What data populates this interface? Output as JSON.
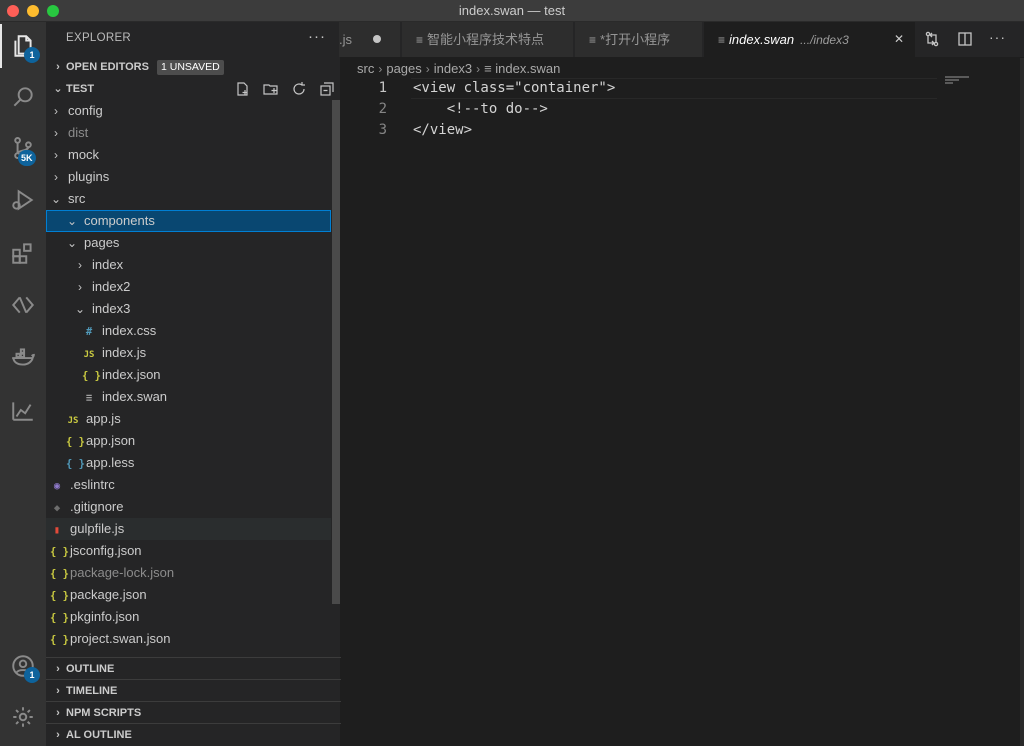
{
  "window": {
    "title": "index.swan — test"
  },
  "activity": {
    "explorer_badge": "1",
    "scm_badge": "5K",
    "accounts_badge": "1"
  },
  "sidebar": {
    "title": "EXPLORER",
    "more": "···",
    "open_editors": {
      "label": "OPEN EDITORS",
      "badge": "1 UNSAVED"
    },
    "folder": {
      "label": "TEST"
    },
    "tree": [
      {
        "label": "config",
        "type": "folder",
        "open": false,
        "depth": 1
      },
      {
        "label": "dist",
        "type": "folder",
        "open": false,
        "depth": 1,
        "dim": true
      },
      {
        "label": "mock",
        "type": "folder",
        "open": false,
        "depth": 1
      },
      {
        "label": "plugins",
        "type": "folder",
        "open": false,
        "depth": 1
      },
      {
        "label": "src",
        "type": "folder",
        "open": true,
        "depth": 1
      },
      {
        "label": "components",
        "type": "folder",
        "open": true,
        "depth": 2,
        "selected": true
      },
      {
        "label": "pages",
        "type": "folder",
        "open": true,
        "depth": 2
      },
      {
        "label": "index",
        "type": "folder",
        "open": false,
        "depth": 3
      },
      {
        "label": "index2",
        "type": "folder",
        "open": false,
        "depth": 3
      },
      {
        "label": "index3",
        "type": "folder",
        "open": true,
        "depth": 3
      },
      {
        "label": "index.css",
        "type": "css",
        "depth": 4
      },
      {
        "label": "index.js",
        "type": "js",
        "depth": 4
      },
      {
        "label": "index.json",
        "type": "json",
        "depth": 4
      },
      {
        "label": "index.swan",
        "type": "swan",
        "depth": 4
      },
      {
        "label": "app.js",
        "type": "js",
        "depth": 2
      },
      {
        "label": "app.json",
        "type": "json",
        "depth": 2
      },
      {
        "label": "app.less",
        "type": "less",
        "depth": 2
      },
      {
        "label": ".eslintrc",
        "type": "eslint",
        "depth": 1
      },
      {
        "label": ".gitignore",
        "type": "git",
        "depth": 1
      },
      {
        "label": "gulpfile.js",
        "type": "gulp",
        "depth": 1,
        "hover": true
      },
      {
        "label": "jsconfig.json",
        "type": "json",
        "depth": 1
      },
      {
        "label": "package-lock.json",
        "type": "json",
        "depth": 1,
        "dim": true
      },
      {
        "label": "package.json",
        "type": "json",
        "depth": 1
      },
      {
        "label": "pkginfo.json",
        "type": "json",
        "depth": 1
      },
      {
        "label": "project.swan.json",
        "type": "json",
        "depth": 1
      }
    ],
    "sections": [
      "OUTLINE",
      "TIMELINE",
      "NPM SCRIPTS",
      "AL OUTLINE"
    ]
  },
  "tabs": [
    {
      "label": ".js",
      "modified": true
    },
    {
      "label": "智能小程序技术特点"
    },
    {
      "label": "*打开小程序"
    },
    {
      "label": "index.swan",
      "desc": ".../index3",
      "active": true
    }
  ],
  "breadcrumb": [
    "src",
    "pages",
    "index3",
    "index.swan"
  ],
  "code": [
    {
      "n": "1",
      "text": "<view class=\"container\">"
    },
    {
      "n": "2",
      "text": "    <!--to do-->"
    },
    {
      "n": "3",
      "text": "</view>"
    }
  ],
  "icons": {
    "css": "#",
    "js": "JS",
    "json": "{ }",
    "less": "{ }",
    "swan": "≡",
    "eslint": "◉",
    "git": "◆",
    "gulp": "▮"
  },
  "colors": {
    "selection": "#094771",
    "accent": "#007fd4",
    "badge": "#0e639c"
  }
}
